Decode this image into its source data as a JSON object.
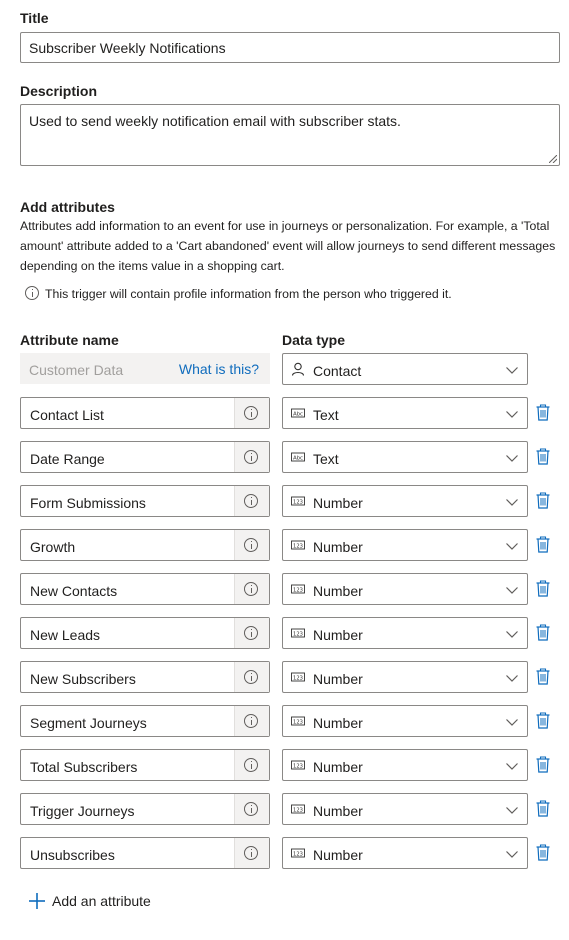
{
  "title_section": {
    "label": "Title",
    "value": "Subscriber Weekly Notifications"
  },
  "description_section": {
    "label": "Description",
    "value": "Used to send weekly notification email with subscriber stats."
  },
  "attributes_section": {
    "heading": "Add attributes",
    "description_line1": "Attributes add information to an event for use in journeys or personalization. For example, a 'Total",
    "description_line2": "amount' attribute added to a 'Cart abandoned' event will allow journeys to send different messages",
    "description_line3": "depending on the items value in a shopping cart.",
    "info_note": "This trigger will contain profile information from the person who triggered it."
  },
  "columns": {
    "attribute_name": "Attribute name",
    "data_type": "Data type"
  },
  "customer_data": {
    "placeholder": "Customer Data",
    "link": "What is this?",
    "type": "Contact",
    "type_icon": "person-icon"
  },
  "attributes": [
    {
      "name": "Contact List",
      "type": "Text",
      "type_icon": "abc-text-icon"
    },
    {
      "name": "Date Range",
      "type": "Text",
      "type_icon": "abc-text-icon"
    },
    {
      "name": "Form Submissions",
      "type": "Number",
      "type_icon": "123-number-icon"
    },
    {
      "name": "Growth",
      "type": "Number",
      "type_icon": "123-number-icon"
    },
    {
      "name": "New Contacts",
      "type": "Number",
      "type_icon": "123-number-icon"
    },
    {
      "name": "New Leads",
      "type": "Number",
      "type_icon": "123-number-icon"
    },
    {
      "name": "New Subscribers",
      "type": "Number",
      "type_icon": "123-number-icon"
    },
    {
      "name": "Segment Journeys",
      "type": "Number",
      "type_icon": "123-number-icon"
    },
    {
      "name": "Total Subscribers",
      "type": "Number",
      "type_icon": "123-number-icon"
    },
    {
      "name": "Trigger Journeys",
      "type": "Number",
      "type_icon": "123-number-icon"
    },
    {
      "name": "Unsubscribes",
      "type": "Number",
      "type_icon": "123-number-icon"
    }
  ],
  "add_attribute_label": "Add an attribute",
  "colors": {
    "accent": "#0f6cbd",
    "border": "#8a8886",
    "disabled_bg": "#f3f2f1"
  }
}
